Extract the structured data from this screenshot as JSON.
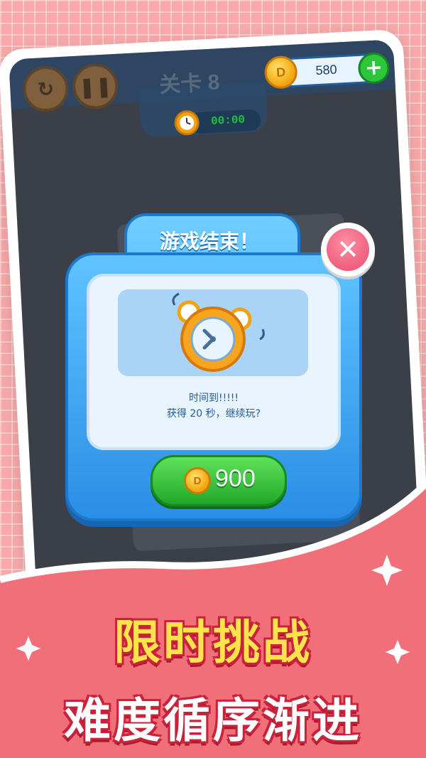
{
  "header": {
    "level_title": "关卡 8",
    "coin_count": "580",
    "coin_symbol": "D",
    "plus_label": "+",
    "timer": "00:00"
  },
  "dialog": {
    "title": "游戏结束！",
    "close_label": "✕",
    "message_line1": "时间到!!!!!",
    "message_line2": "获得 20 秒，继续玩?",
    "buy_cost": "900",
    "coin_symbol": "D"
  },
  "banner": {
    "line1": "限时挑战",
    "line2": "难度循序渐进"
  },
  "colors": {
    "accent_blue": "#2a8ee6",
    "accent_green": "#22a829",
    "banner_red": "#f06f78",
    "slogan_yellow": "#ffe34d"
  }
}
